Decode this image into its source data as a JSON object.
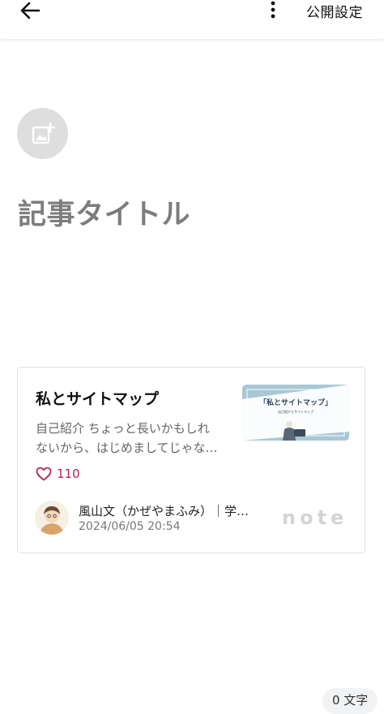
{
  "header": {
    "back_icon": "arrow-left-icon",
    "more_icon": "more-vertical-icon",
    "publish_label": "公開設定"
  },
  "editor": {
    "add_image_icon": "add-image-icon",
    "title_placeholder": "記事タイトル"
  },
  "embed": {
    "title": "私とサイトマップ",
    "excerpt_line1": "自己紹介 ちょっと長いかもしれ",
    "excerpt_line2": "ないから、はじめましてじゃな…",
    "thumb_title": "「私とサイトマップ」",
    "thumb_subtitle": "自己紹介とサイトマップ",
    "likes_icon": "heart-outline-icon",
    "likes": "110",
    "author": "風山文（かぜやまふみ）｜学…",
    "date": "2024/06/05 20:54",
    "logo": "note"
  },
  "footer": {
    "char_count": "0 文字"
  },
  "colors": {
    "accent_pink": "#b5245b",
    "thumb_bg": "#a9c8d6",
    "placeholder_gray": "#7d7d7d"
  }
}
